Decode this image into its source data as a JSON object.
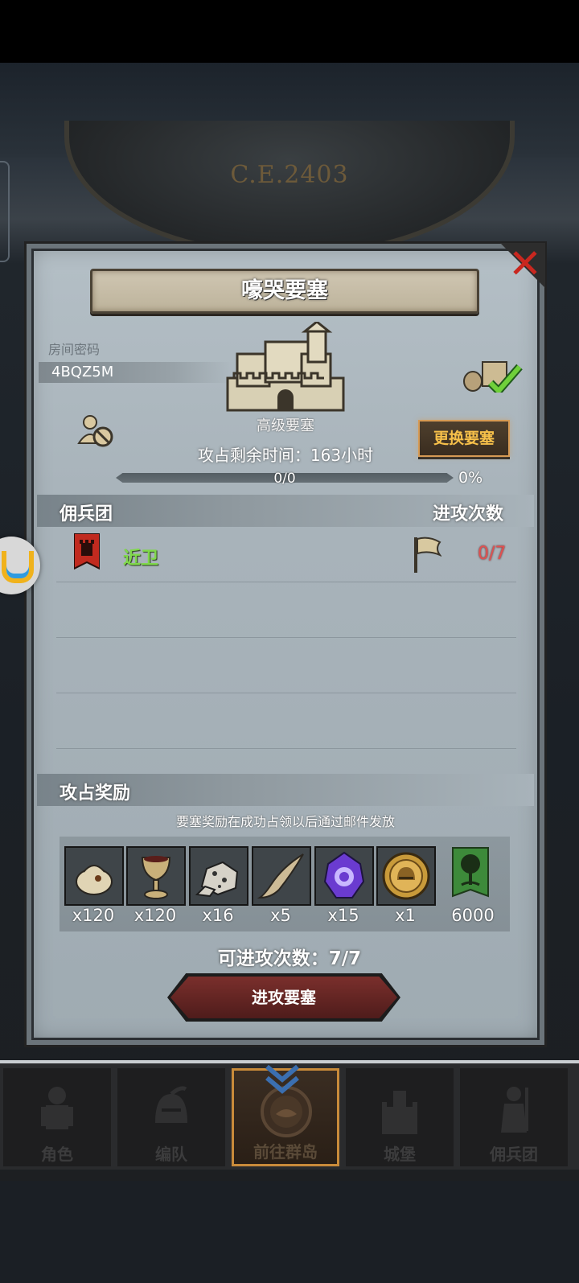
{
  "header": {
    "year_label": "C.E.2403"
  },
  "dialog": {
    "title": "嚎哭要塞",
    "room_label": "房间密码",
    "room_code": "4BQZ5M",
    "fortress_type": "高级要塞",
    "change_button": "更换要塞",
    "remaining_time": "攻占剩余时间：163小时",
    "progress": {
      "text": "0/0",
      "percent_text": "0%",
      "fraction": 0
    },
    "section_mercenary": {
      "left": "佣兵团",
      "right": "进攻次数"
    },
    "mercenary_rows": [
      {
        "name": "近卫",
        "attacks": "0/7"
      }
    ],
    "rewards_section": {
      "title": "攻占奖励",
      "note": "要塞奖励在成功占领以后通过邮件发放"
    },
    "rewards": [
      {
        "icon": "sack-icon",
        "qty": "x120"
      },
      {
        "icon": "goblet-icon",
        "qty": "x120"
      },
      {
        "icon": "ore-icon",
        "qty": "x16"
      },
      {
        "icon": "horn-icon",
        "qty": "x5"
      },
      {
        "icon": "purple-crystal-icon",
        "qty": "x15"
      },
      {
        "icon": "gold-helmet-coin-icon",
        "qty": "x1"
      },
      {
        "icon": "tree-banner-icon",
        "qty": "6000"
      }
    ],
    "attempts": "可进攻次数：7/7",
    "attack_button": "进攻要塞"
  },
  "nav": [
    {
      "label": "角色",
      "icon": "knight-icon"
    },
    {
      "label": "编队",
      "icon": "helmet-icon"
    },
    {
      "label": "前往群岛",
      "icon": "island-compass-icon",
      "active": true
    },
    {
      "label": "城堡",
      "icon": "castle-icon"
    },
    {
      "label": "佣兵团",
      "icon": "soldier-icon"
    }
  ],
  "colors": {
    "accent_gold": "#f6c04a",
    "green_name": "#7fd84a",
    "red_count": "#e05050"
  }
}
